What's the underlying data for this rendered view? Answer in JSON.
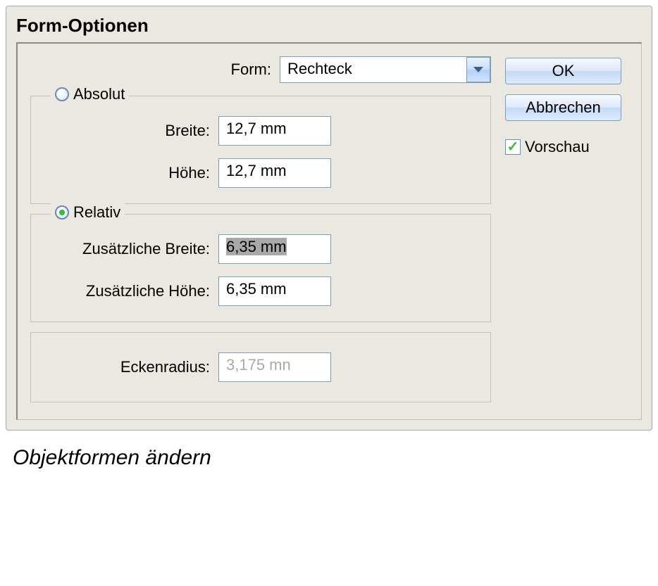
{
  "dialog": {
    "title": "Form-Optionen",
    "form_label": "Form:",
    "form_value": "Rechteck",
    "absolut": {
      "legend": "Absolut",
      "breite_label": "Breite:",
      "breite_value": "12,7 mm",
      "hoehe_label": "Höhe:",
      "hoehe_value": "12,7 mm"
    },
    "relativ": {
      "legend": "Relativ",
      "zus_breite_label": "Zusätzliche Breite:",
      "zus_breite_value": "6,35 mm",
      "zus_hoehe_label": "Zusätzliche Höhe:",
      "zus_hoehe_value": "6,35 mm"
    },
    "radius": {
      "label": "Eckenradius:",
      "value": "3,175 mn"
    },
    "buttons": {
      "ok": "OK",
      "cancel": "Abbrechen"
    },
    "preview_label": "Vorschau"
  },
  "caption": "Objektformen ändern"
}
